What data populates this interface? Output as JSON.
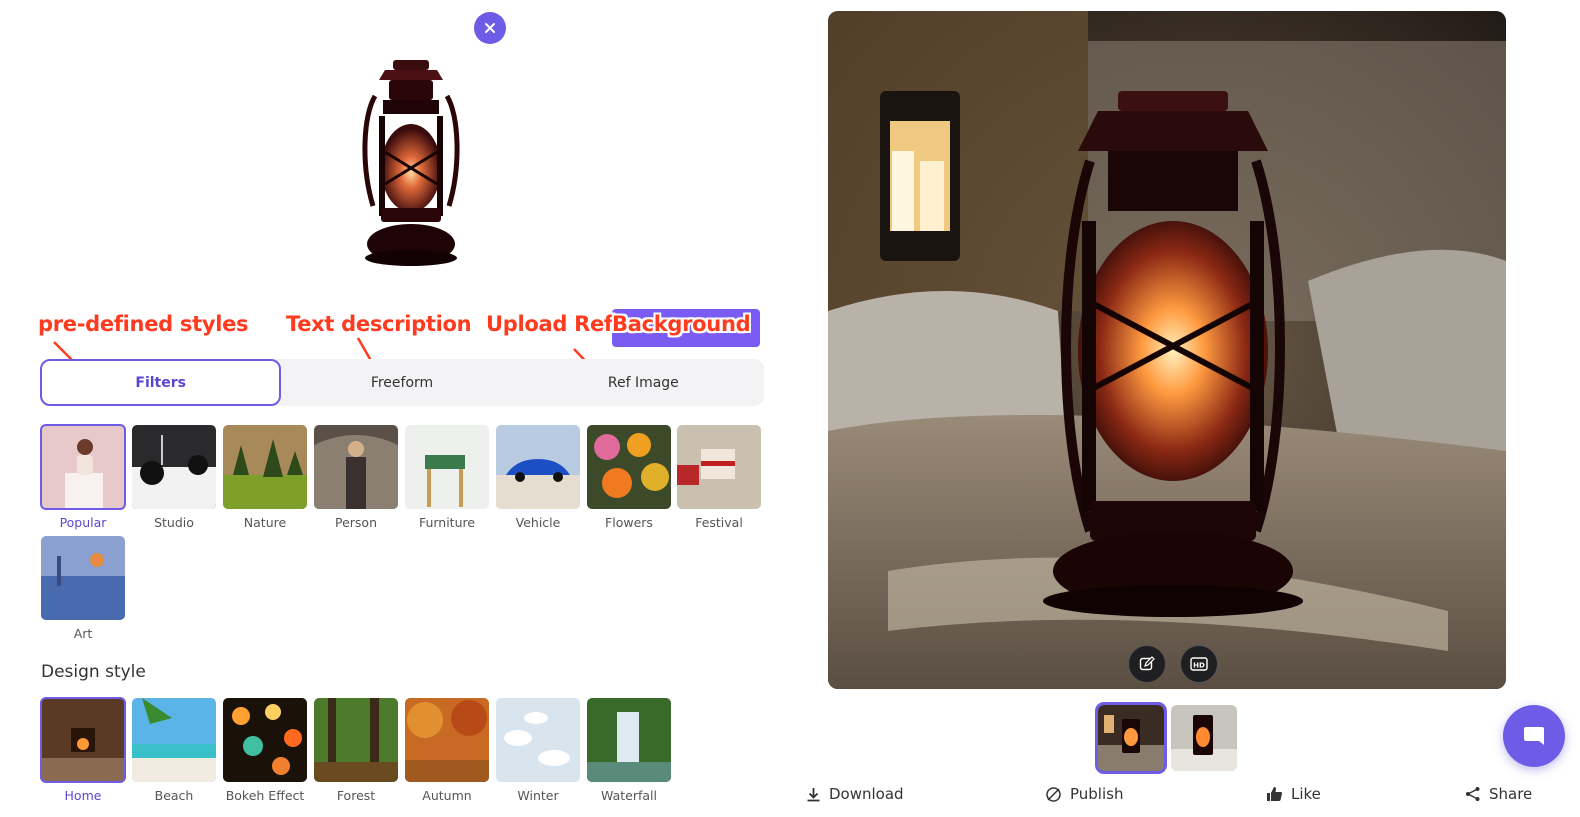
{
  "close_button": {
    "icon": "close-icon"
  },
  "annotations": {
    "predefined": "pre-defined styles",
    "text_description": "Text description",
    "upload_ref": "Upload Ref",
    "background": "Background"
  },
  "mode_tabs": {
    "filters": "Filters",
    "freeform": "Freeform",
    "ref_image": "Ref Image"
  },
  "filters": [
    {
      "label": "Popular",
      "selected": true
    },
    {
      "label": "Studio"
    },
    {
      "label": "Nature"
    },
    {
      "label": "Person"
    },
    {
      "label": "Furniture"
    },
    {
      "label": "Vehicle"
    },
    {
      "label": "Flowers"
    },
    {
      "label": "Festival"
    },
    {
      "label": "Art"
    }
  ],
  "design_style": {
    "title": "Design style",
    "items": [
      {
        "label": "Home",
        "selected": true
      },
      {
        "label": "Beach"
      },
      {
        "label": "Bokeh Effect"
      },
      {
        "label": "Forest"
      },
      {
        "label": "Autumn"
      },
      {
        "label": "Winter"
      },
      {
        "label": "Waterfall"
      }
    ]
  },
  "preview_tools": [
    "edit-icon",
    "hd-icon"
  ],
  "actions": {
    "download": "Download",
    "publish": "Publish",
    "like": "Like",
    "share": "Share"
  },
  "colors": {
    "accent": "#6e5ce6",
    "annotation": "#ff3b1f"
  }
}
